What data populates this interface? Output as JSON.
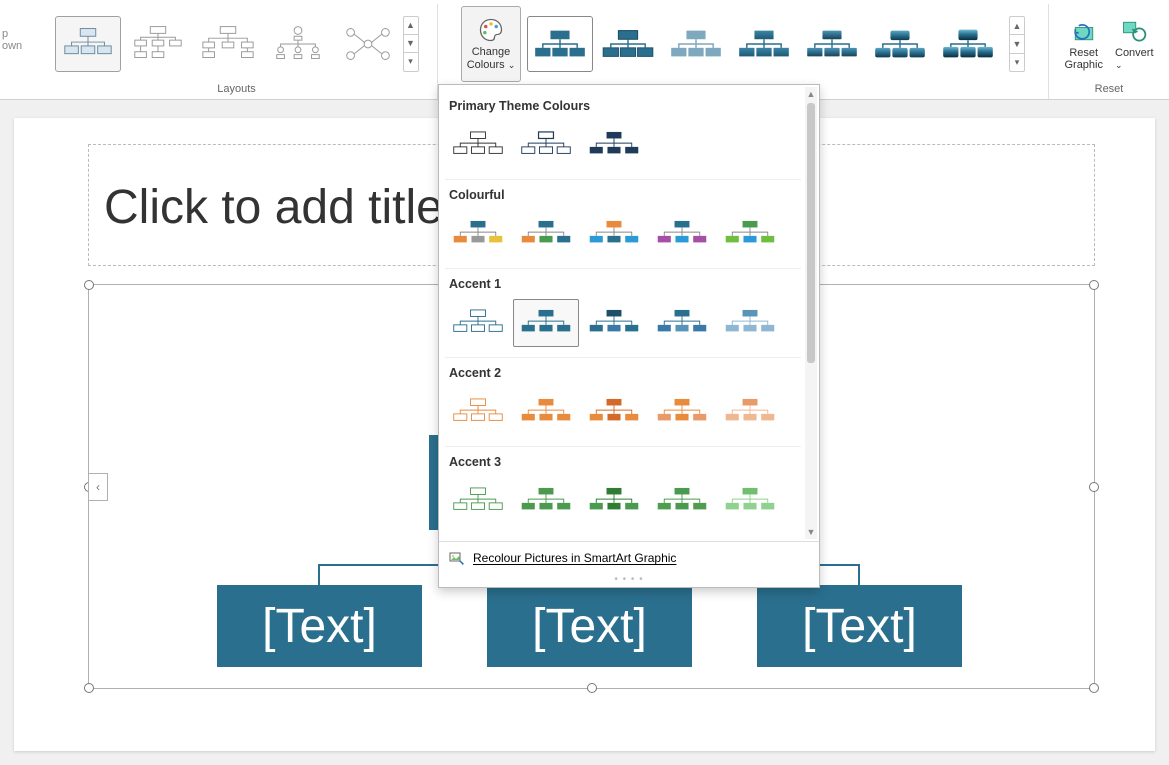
{
  "ribbon": {
    "truncated_label_top": "p",
    "truncated_label_bottom": "own",
    "layouts_label": "Layouts",
    "change_colours_label": "Change\nColours",
    "styles_label": "",
    "reset_label": "Reset",
    "reset_graphic_label": "Reset\nGraphic",
    "convert_label": "Convert"
  },
  "dropdown": {
    "sections": {
      "primary": "Primary Theme Colours",
      "colourful": "Colourful",
      "accent1": "Accent 1",
      "accent2": "Accent 2",
      "accent3": "Accent 3"
    },
    "footer_label": "Recolour Pictures in SmartArt Graphic"
  },
  "slide": {
    "title_placeholder": "Click to add title",
    "smartart_text": "[Text]"
  },
  "colors": {
    "accent_teal": "#2a6f8e",
    "dark_navy": "#1f3b5a",
    "mid_blue": "#3b79a8",
    "light_blue": "#8fb7d3",
    "slate": "#7a95a8",
    "orange": "#e88b3c",
    "green": "#4a9b4f",
    "cyan": "#2a9bd6",
    "purple": "#a64fa6",
    "lime": "#6fbf3f",
    "dark_orange": "#d36a2a",
    "salmon": "#e89a6a",
    "dark_green": "#2f7d33",
    "mid_green": "#4f9e4f"
  }
}
